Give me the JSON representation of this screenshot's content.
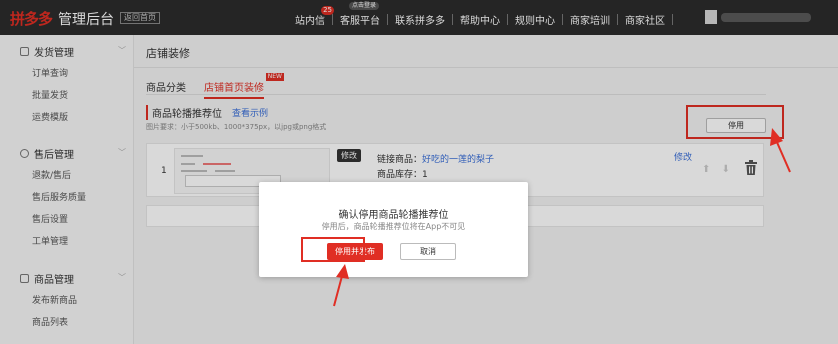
{
  "topbar": {
    "logo": "拼多多",
    "title": "管理后台",
    "home_link": "返回首页",
    "nav": [
      {
        "label": "站内信",
        "badge": "25"
      },
      {
        "label": "客服平台",
        "tip": "点击登录"
      },
      {
        "label": "联系拼多多"
      },
      {
        "label": "帮助中心"
      },
      {
        "label": "规则中心"
      },
      {
        "label": "商家培训"
      },
      {
        "label": "商家社区"
      }
    ]
  },
  "sidebar": {
    "sections": [
      {
        "title": "发货管理",
        "items": [
          "订单查询",
          "批量发货",
          "运费模版"
        ]
      },
      {
        "title": "售后管理",
        "items": [
          "退款/售后",
          "售后服务质量",
          "售后设置",
          "工单管理"
        ]
      },
      {
        "title": "商品管理",
        "items": [
          "发布新商品",
          "商品列表"
        ]
      }
    ]
  },
  "main": {
    "page_title": "店铺装修",
    "tabs": [
      {
        "label": "商品分类",
        "active": false
      },
      {
        "label": "店铺首页装修",
        "active": true,
        "tag": "NEW"
      }
    ],
    "slot": {
      "title": "商品轮播推荐位",
      "example_link": "查看示例",
      "requirement": "图片要求：小于500kb、1000*375px，以jpg或png格式",
      "disable_label": "停用"
    },
    "row": {
      "index": "1",
      "edit_badge": "修改",
      "link_label": "链接商品：",
      "link_value": "好吃的一莲的梨子",
      "stock": "商品库存：1",
      "edit_link": "修改"
    }
  },
  "modal": {
    "title": "确认停用商品轮播推荐位",
    "subtitle": "停用后，商品轮播推荐位将在App不可见",
    "confirm_label": "停用并发布",
    "cancel_label": "取消"
  },
  "colors": {
    "accent": "#e02e24",
    "link": "#3a6fd8",
    "topbar_bg": "#2c2c2c"
  }
}
